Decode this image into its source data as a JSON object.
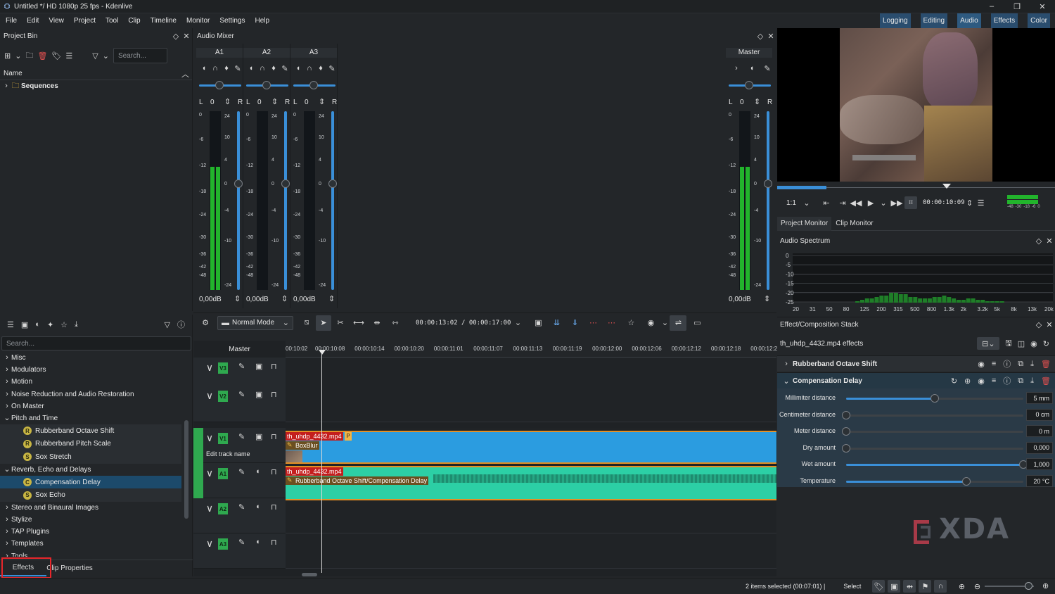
{
  "window": {
    "title": "Untitled */ HD 1080p 25 fps - Kdenlive",
    "app_icon": "kdenlive-icon",
    "controls": [
      "minimize-icon",
      "maximize-icon",
      "close-icon"
    ]
  },
  "menu": [
    "File",
    "Edit",
    "View",
    "Project",
    "Tool",
    "Clip",
    "Timeline",
    "Monitor",
    "Settings",
    "Help"
  ],
  "workspaces": [
    "Logging",
    "Editing",
    "Audio",
    "Effects",
    "Color"
  ],
  "project_bin": {
    "title": "Project Bin",
    "search_placeholder": "Search...",
    "column": "Name",
    "folder": "Sequences"
  },
  "audio_mixer": {
    "title": "Audio Mixer",
    "channels": [
      {
        "name": "A1",
        "l": "L",
        "r": "R",
        "value": "0",
        "db": "0,00dB"
      },
      {
        "name": "A2",
        "l": "L",
        "r": "R",
        "value": "0",
        "db": "0,00dB"
      },
      {
        "name": "A3",
        "l": "L",
        "r": "R",
        "value": "0",
        "db": "0,00dB"
      }
    ],
    "master": {
      "name": "Master",
      "l": "L",
      "r": "R",
      "value": "0",
      "db": "0,00dB"
    },
    "left_scale": [
      "0",
      "-6",
      "-12",
      "-18",
      "-24",
      "-30",
      "-36",
      "-42",
      "-48"
    ],
    "right_scale": [
      "24",
      "10",
      "4",
      "0",
      "-4",
      "-10",
      "-24"
    ]
  },
  "effects_list": {
    "search_placeholder": "Search...",
    "items": [
      {
        "label": "Misc",
        "level": 0
      },
      {
        "label": "Modulators",
        "level": 0
      },
      {
        "label": "Motion",
        "level": 0
      },
      {
        "label": "Noise Reduction and Audio Restoration",
        "level": 0
      },
      {
        "label": "On Master",
        "level": 0
      },
      {
        "label": "Pitch and Time",
        "level": 0,
        "open": true
      },
      {
        "label": "Rubberband Octave Shift",
        "level": 1,
        "badge": "R"
      },
      {
        "label": "Rubberband Pitch Scale",
        "level": 1,
        "badge": "R"
      },
      {
        "label": "Sox Stretch",
        "level": 1,
        "badge": "S"
      },
      {
        "label": "Reverb, Echo and Delays",
        "level": 0,
        "open": true
      },
      {
        "label": "Compensation Delay",
        "level": 1,
        "badge": "C",
        "selected": true
      },
      {
        "label": "Sox Echo",
        "level": 1,
        "badge": "S"
      },
      {
        "label": "Stereo and Binaural Images",
        "level": 0
      },
      {
        "label": "Stylize",
        "level": 0
      },
      {
        "label": "TAP Plugins",
        "level": 0
      },
      {
        "label": "Templates",
        "level": 0
      },
      {
        "label": "Tools",
        "level": 0
      }
    ],
    "tabs": [
      "Effects",
      "Clip Properties"
    ]
  },
  "timeline": {
    "mode": "Normal Mode",
    "timecode": "00:00:13:02 / 00:00:17:00",
    "master_label": "Master",
    "ruler": [
      "00:10:02",
      "00:00:10:08",
      "00:00:10:14",
      "00:00:10:20",
      "00:00:11:01",
      "00:00:11:07",
      "00:00:11:13",
      "00:00:11:19",
      "00:00:12:00",
      "00:00:12:06",
      "00:00:12:12",
      "00:00:12:18",
      "00:00:12:2"
    ],
    "tracks": [
      "V3",
      "V2",
      "V1",
      "A1",
      "A2",
      "A3"
    ],
    "edit_track_name": "Edit track name",
    "video_clip": {
      "name": "th_uhdp_4432.mp4",
      "marker": "P",
      "effect": "BoxBlur"
    },
    "audio_clip": {
      "name": "th_uhdp_4432.mp4",
      "effect": "Rubberband Octave Shift/Compensation Delay"
    }
  },
  "monitor": {
    "zoom": "1:1",
    "timecode": "00:00:10:09",
    "tabs": [
      "Project Monitor",
      "Clip Monitor"
    ],
    "meter_labels": [
      "-48",
      "-30",
      "-18",
      "-6",
      "0"
    ]
  },
  "audio_spectrum": {
    "title": "Audio Spectrum",
    "y_labels": [
      "0",
      "-5",
      "-10",
      "-15",
      "-20",
      "-25"
    ],
    "x_labels": [
      "20",
      "31",
      "50",
      "80",
      "125",
      "200",
      "315",
      "500",
      "800",
      "1.3k",
      "2k",
      "3.2k",
      "5k",
      "8k",
      "13k",
      "20k"
    ],
    "bars": [
      0,
      0,
      0,
      0,
      0,
      0,
      0,
      0,
      0,
      0,
      0,
      0,
      0,
      2,
      4,
      6,
      6,
      8,
      10,
      10,
      14,
      14,
      12,
      12,
      8,
      8,
      6,
      6,
      6,
      8,
      8,
      10,
      8,
      6,
      4,
      4,
      6,
      6,
      4,
      4,
      2,
      2,
      2,
      2,
      0,
      0,
      0,
      0,
      0,
      0,
      0,
      0,
      0,
      0
    ]
  },
  "effect_stack": {
    "title": "Effect/Composition Stack",
    "clip_effects": "th_uhdp_4432.mp4 effects",
    "effects": [
      {
        "name": "Rubberband Octave Shift",
        "expanded": false
      },
      {
        "name": "Compensation Delay",
        "expanded": true
      }
    ],
    "params": [
      {
        "label": "Millimiter distance",
        "value": "5 mm",
        "fraction": 0.5
      },
      {
        "label": "Centimeter distance",
        "value": "0 cm",
        "fraction": 0.0
      },
      {
        "label": "Meter distance",
        "value": "0 m",
        "fraction": 0.0
      },
      {
        "label": "Dry amount",
        "value": "0,000",
        "fraction": 0.0
      },
      {
        "label": "Wet amount",
        "value": "1,000",
        "fraction": 1.0
      },
      {
        "label": "Temperature",
        "value": "20 °C",
        "fraction": 0.68
      }
    ]
  },
  "status": {
    "selected": "2 items selected (00:07:01) |",
    "tool": "Select"
  },
  "watermark": "XDA",
  "colors": {
    "accent": "#3a8fd8",
    "video_clip": "#2b9ce0",
    "audio_clip": "#2ccfa5",
    "track_badge": "#2fa94f",
    "highlight": "#e8262b"
  }
}
